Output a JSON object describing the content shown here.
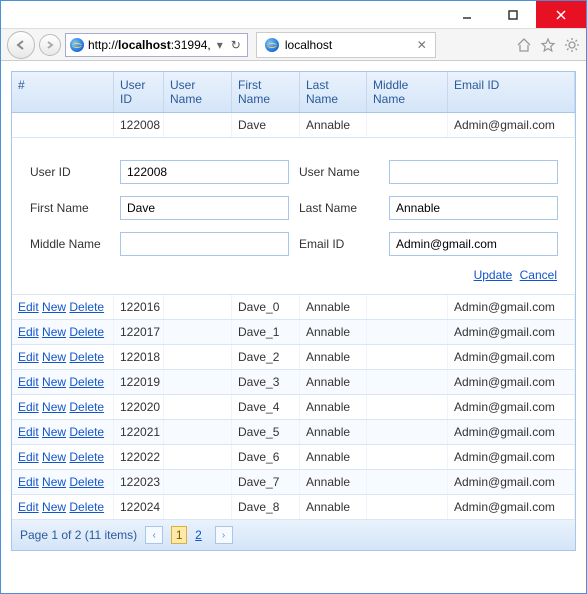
{
  "browser": {
    "url_prefix": "http://",
    "url_host": "localhost",
    "url_suffix": ":31994,",
    "tab_title": "localhost"
  },
  "grid": {
    "headers": {
      "actions": "#",
      "user_id": "User ID",
      "user_name": "User Name",
      "first_name": "First Name",
      "last_name": "Last Name",
      "middle_name": "Middle Name",
      "email_id": "Email ID"
    },
    "edit_row": {
      "user_id": "122008",
      "user_name": "",
      "first_name": "Dave",
      "last_name": "Annable",
      "middle_name": "",
      "email_id": "Admin@gmail.com"
    },
    "form": {
      "labels": {
        "user_id": "User ID",
        "user_name": "User Name",
        "first_name": "First Name",
        "last_name": "Last Name",
        "middle_name": "Middle Name",
        "email_id": "Email ID"
      },
      "values": {
        "user_id": "122008",
        "user_name": "",
        "first_name": "Dave",
        "last_name": "Annable",
        "middle_name": "",
        "email_id": "Admin@gmail.com"
      },
      "update": "Update",
      "cancel": "Cancel"
    },
    "action_labels": {
      "edit": "Edit",
      "new": "New",
      "delete": "Delete"
    },
    "rows": [
      {
        "user_id": "122016",
        "user_name": "",
        "first_name": "Dave_0",
        "last_name": "Annable",
        "middle_name": "",
        "email_id": "Admin@gmail.com"
      },
      {
        "user_id": "122017",
        "user_name": "",
        "first_name": "Dave_1",
        "last_name": "Annable",
        "middle_name": "",
        "email_id": "Admin@gmail.com"
      },
      {
        "user_id": "122018",
        "user_name": "",
        "first_name": "Dave_2",
        "last_name": "Annable",
        "middle_name": "",
        "email_id": "Admin@gmail.com"
      },
      {
        "user_id": "122019",
        "user_name": "",
        "first_name": "Dave_3",
        "last_name": "Annable",
        "middle_name": "",
        "email_id": "Admin@gmail.com"
      },
      {
        "user_id": "122020",
        "user_name": "",
        "first_name": "Dave_4",
        "last_name": "Annable",
        "middle_name": "",
        "email_id": "Admin@gmail.com"
      },
      {
        "user_id": "122021",
        "user_name": "",
        "first_name": "Dave_5",
        "last_name": "Annable",
        "middle_name": "",
        "email_id": "Admin@gmail.com"
      },
      {
        "user_id": "122022",
        "user_name": "",
        "first_name": "Dave_6",
        "last_name": "Annable",
        "middle_name": "",
        "email_id": "Admin@gmail.com"
      },
      {
        "user_id": "122023",
        "user_name": "",
        "first_name": "Dave_7",
        "last_name": "Annable",
        "middle_name": "",
        "email_id": "Admin@gmail.com"
      },
      {
        "user_id": "122024",
        "user_name": "",
        "first_name": "Dave_8",
        "last_name": "Annable",
        "middle_name": "",
        "email_id": "Admin@gmail.com"
      }
    ]
  },
  "pager": {
    "summary": "Page 1 of 2 (11 items)",
    "pages": [
      "1",
      "2"
    ],
    "current": "1"
  }
}
